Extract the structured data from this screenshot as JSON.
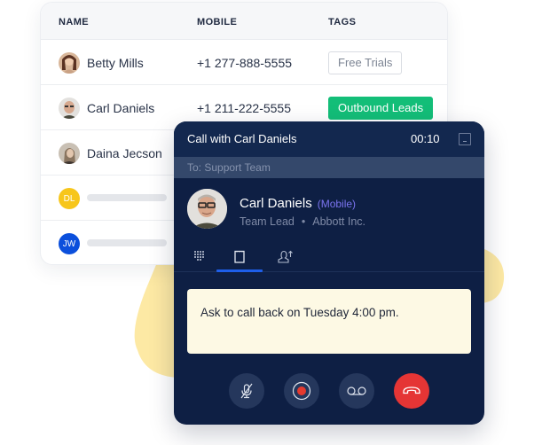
{
  "table": {
    "headers": {
      "name": "NAME",
      "mobile": "MOBILE",
      "tags": "TAGS"
    },
    "rows": [
      {
        "name": "Betty Mills",
        "mobile": "+1 277-888-5555",
        "tag": "Free Trials",
        "tag_style": "outline",
        "avatar": "photo"
      },
      {
        "name": "Carl Daniels",
        "mobile": "+1 211-222-5555",
        "tag": "Outbound Leads",
        "tag_style": "green",
        "avatar": "photo"
      },
      {
        "name": "Daina Jecson",
        "mobile": "",
        "tag": "",
        "avatar": "photo"
      },
      {
        "name": "",
        "initials": "DL",
        "avatar_color": "#f7c61b",
        "placeholder": true
      },
      {
        "name": "",
        "initials": "JW",
        "avatar_color": "#0b4fdc",
        "placeholder": true
      }
    ]
  },
  "call": {
    "title": "Call with Carl Daniels",
    "timer": "00:10",
    "to": "To: Support Team",
    "contact": {
      "name": "Carl Daniels",
      "number_type": "(Mobile)",
      "role": "Team Lead",
      "separator": "•",
      "company": "Abbott Inc."
    },
    "tabs": [
      {
        "id": "keypad",
        "icon": "keypad-icon",
        "active": false
      },
      {
        "id": "notes",
        "icon": "notepad-icon",
        "active": true
      },
      {
        "id": "transfer",
        "icon": "transfer-user-icon",
        "active": false
      }
    ],
    "note": "Ask to call back on Tuesday 4:00 pm.",
    "controls": [
      {
        "id": "mute",
        "icon": "microphone-off-icon"
      },
      {
        "id": "record",
        "icon": "record-icon"
      },
      {
        "id": "voicemail",
        "icon": "voicemail-icon"
      },
      {
        "id": "hangup",
        "icon": "phone-hangup-icon"
      }
    ]
  },
  "colors": {
    "panel": "#0e1f44",
    "accent_blue": "#1e5fea",
    "tag_green": "#13be78",
    "hangup_red": "#e53535",
    "note_bg": "#fdf9e4",
    "mobile_label": "#7b74f0",
    "blob_yellow": "#fde9a4"
  }
}
